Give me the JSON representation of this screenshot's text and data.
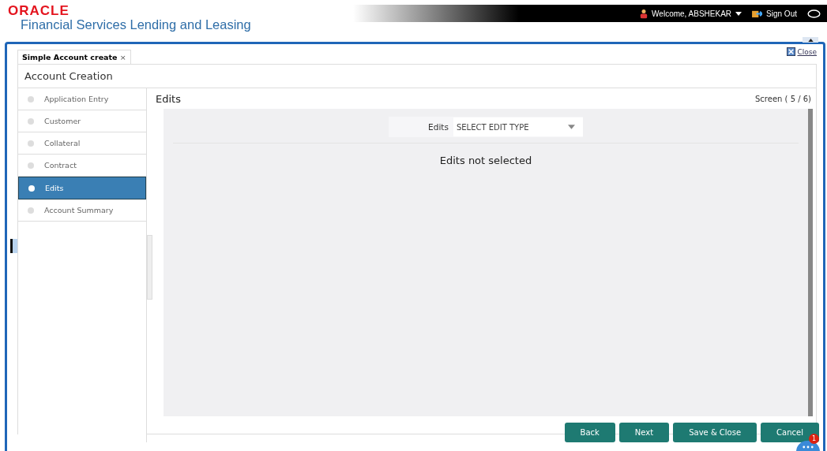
{
  "header": {
    "brand": "ORACLE",
    "product": "Financial Services Lending and Leasing",
    "welcome": "Welcome, ABSHEKAR",
    "sign_out": "Sign Out"
  },
  "tabs": [
    {
      "label": "Simple Account create",
      "close": "×",
      "selected": true
    }
  ],
  "close_link": "Close",
  "page_title": "Account Creation",
  "steps": [
    {
      "label": "Application Entry",
      "selected": false
    },
    {
      "label": "Customer",
      "selected": false
    },
    {
      "label": "Collateral",
      "selected": false
    },
    {
      "label": "Contract",
      "selected": false
    },
    {
      "label": "Edits",
      "selected": true
    },
    {
      "label": "Account Summary",
      "selected": false
    }
  ],
  "content": {
    "title": "Edits",
    "screen": "Screen ( 5 / 6)",
    "field_label": "Edits",
    "select_value": "SELECT EDIT TYPE",
    "message": "Edits not selected"
  },
  "buttons": [
    "Back",
    "Next",
    "Save & Close",
    "Cancel"
  ],
  "chat": {
    "badge": "1"
  }
}
